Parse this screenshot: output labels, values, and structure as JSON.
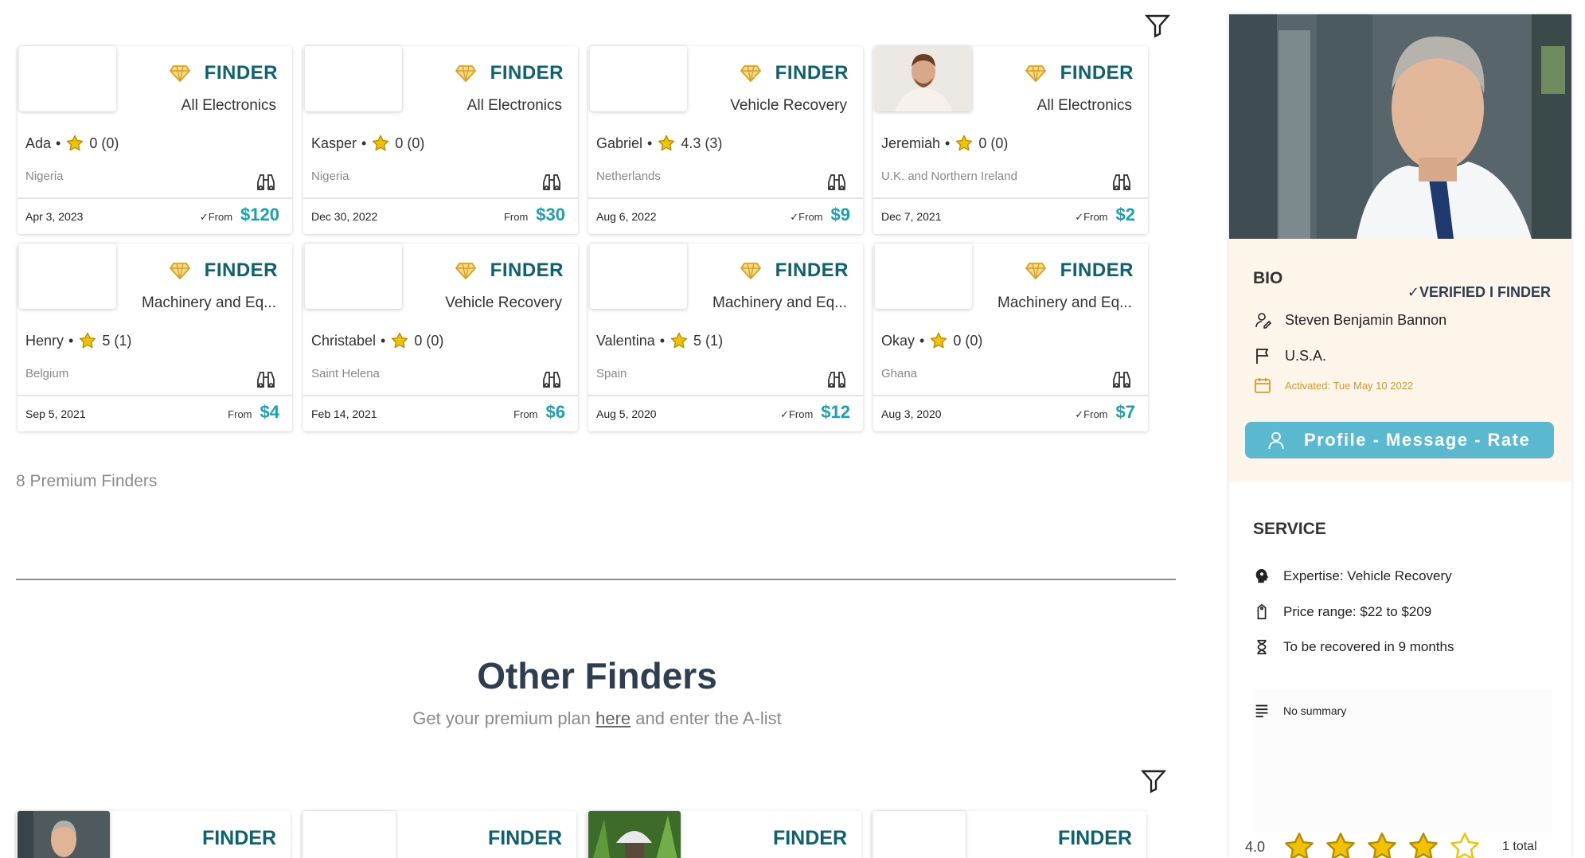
{
  "premium": {
    "badge_word": "FINDER",
    "cards": [
      {
        "category": "All Electronics",
        "name": "Ada",
        "rating": "0 (0)",
        "country": "Nigeria",
        "date": "Apr 3, 2023",
        "from_label": "✓From",
        "price": "$120",
        "has_photo": false
      },
      {
        "category": "All Electronics",
        "name": "Kasper",
        "rating": "0 (0)",
        "country": "Nigeria",
        "date": "Dec 30, 2022",
        "from_label": "From",
        "price": "$30",
        "has_photo": false
      },
      {
        "category": "Vehicle Recovery",
        "name": "Gabriel",
        "rating": "4.3 (3)",
        "country": "Netherlands",
        "date": "Aug 6, 2022",
        "from_label": "✓From",
        "price": "$9",
        "has_photo": false
      },
      {
        "category": "All Electronics",
        "name": "Jeremiah",
        "rating": "0 (0)",
        "country": "U.K. and Northern Ireland",
        "date": "Dec 7, 2021",
        "from_label": "✓From",
        "price": "$2",
        "has_photo": true
      },
      {
        "category": "Machinery and Eq...",
        "name": "Henry",
        "rating": "5 (1)",
        "country": "Belgium",
        "date": "Sep 5, 2021",
        "from_label": "From",
        "price": "$4",
        "has_photo": false
      },
      {
        "category": "Vehicle Recovery",
        "name": "Christabel ",
        "rating": "0 (0)",
        "country": "Saint Helena",
        "date": "Feb 14, 2021",
        "from_label": "From",
        "price": "$6",
        "has_photo": false
      },
      {
        "category": "Machinery and Eq...",
        "name": "Valentina",
        "rating": "5 (1)",
        "country": "Spain",
        "date": "Aug 5, 2020",
        "from_label": "✓From",
        "price": "$12",
        "has_photo": false
      },
      {
        "category": "Machinery and Eq...",
        "name": "Okay ",
        "rating": "0 (0)",
        "country": "Ghana",
        "date": "Aug 3, 2020",
        "from_label": "✓From",
        "price": "$7",
        "has_photo": false
      }
    ],
    "count_text": "8 Premium Finders"
  },
  "other": {
    "title": "Other Finders",
    "subtitle_before": "Get your premium plan ",
    "subtitle_link": "here",
    "subtitle_after": " and enter the A-list",
    "cards": [
      {
        "word": "FINDER",
        "thumb": "photo-man"
      },
      {
        "word": "FINDER",
        "thumb": "empty"
      },
      {
        "word": "FINDER",
        "thumb": "photo-plant"
      },
      {
        "word": "FINDER",
        "thumb": "empty"
      }
    ]
  },
  "panel": {
    "bio_title": "BIO",
    "verified": "✓VERIFIED I FINDER",
    "full_name": "Steven Benjamin Bannon",
    "country": "U.S.A.",
    "activated": "Activated: Tue May 10 2022",
    "action_label": "Profile - Message - Rate",
    "service_title": "SERVICE",
    "expertise": "Expertise: Vehicle Recovery",
    "price_range": "Price range: $22 to $209",
    "recovery": "To be recovered in 9 months",
    "summary": "No summary",
    "rating_value": "4.0",
    "rating_stars_filled": 4,
    "rating_stars_total": 5,
    "rating_total": "1 total"
  },
  "colors": {
    "finder_text": "#0e6170",
    "price": "#1aa2b3",
    "gem": "#d9a11f",
    "action_button": "#5bb9cf",
    "bio_background": "#fdf4ea",
    "star": "#f2c200"
  }
}
